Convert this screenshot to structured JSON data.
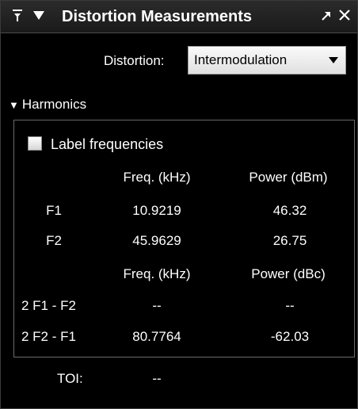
{
  "window": {
    "title": "Distortion Measurements",
    "pin_icon": "pin-icon",
    "collapse_icon": "triangle-down-icon",
    "undock_icon": "undock-arrow-icon",
    "close_icon": "close-icon"
  },
  "distortion": {
    "label": "Distortion:",
    "selected": "Intermodulation",
    "arrow_icon": "chevron-down-icon"
  },
  "harmonics": {
    "section_label": "Harmonics",
    "label_frequencies": "Label frequencies",
    "label_frequencies_checked": false,
    "header1": {
      "freq": "Freq. (kHz)",
      "power": "Power (dBm)"
    },
    "fundamentals": [
      {
        "label": "F1",
        "freq": "10.9219",
        "power": "46.32"
      },
      {
        "label": "F2",
        "freq": "45.9629",
        "power": "26.75"
      }
    ],
    "header2": {
      "freq": "Freq. (kHz)",
      "power": "Power (dBc)"
    },
    "products": [
      {
        "label": "2 F1 - F2",
        "freq": "--",
        "power": "--"
      },
      {
        "label": "2 F2 - F1",
        "freq": "80.7764",
        "power": "-62.03"
      }
    ]
  },
  "toi": {
    "label": "TOI:",
    "value": "--"
  }
}
